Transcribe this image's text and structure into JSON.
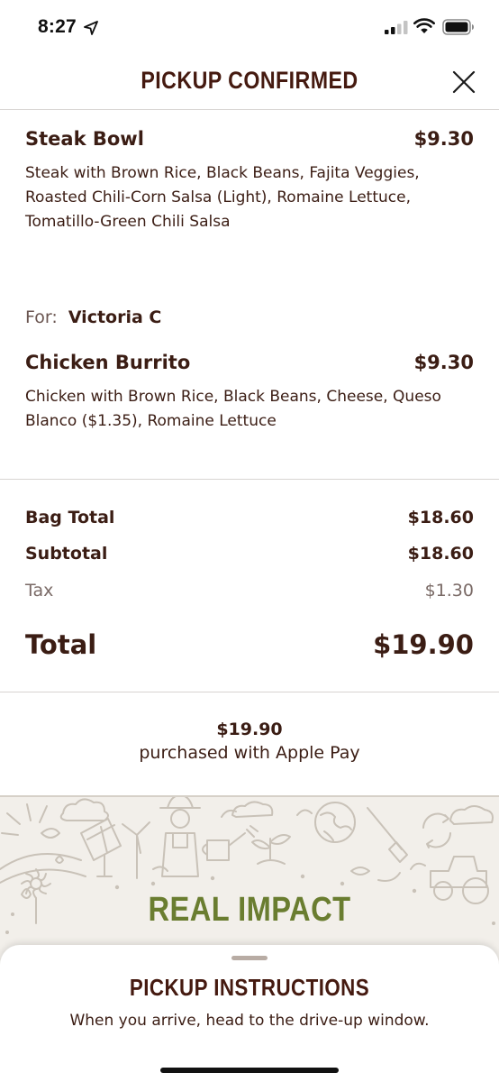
{
  "status_bar": {
    "time": "8:27"
  },
  "header": {
    "title": "PICKUP CONFIRMED"
  },
  "items": [
    {
      "name": "Steak Bowl",
      "price": "$9.30",
      "description": "Steak with Brown Rice, Black Beans, Fajita Veggies, Roasted Chili-Corn Salsa (Light), Romaine Lettuce, Tomatillo-Green Chili Salsa"
    },
    {
      "for_label": "For:",
      "for_name": "Victoria C",
      "name": "Chicken Burrito",
      "price": "$9.30",
      "description": "Chicken with Brown Rice, Black Beans, Cheese, Queso Blanco ($1.35), Romaine Lettuce"
    }
  ],
  "totals": {
    "bag_total_label": "Bag Total",
    "bag_total": "$18.60",
    "subtotal_label": "Subtotal",
    "subtotal": "$18.60",
    "tax_label": "Tax",
    "tax": "$1.30",
    "total_label": "Total",
    "total": "$19.90"
  },
  "payment": {
    "amount": "$19.90",
    "method_text": "purchased with Apple Pay"
  },
  "impact": {
    "title": "REAL IMPACT"
  },
  "sheet": {
    "title": "PICKUP INSTRUCTIONS",
    "text": "When you arrive, head to the drive-up window."
  },
  "colors": {
    "brand_brown": "#451a10",
    "text_brown": "#3b1d14",
    "impact_green": "#6a7d30",
    "impact_bg": "#f2efea"
  },
  "icons": [
    "location-arrow-icon",
    "cellular-signal-icon",
    "wifi-icon",
    "battery-icon",
    "close-icon"
  ]
}
